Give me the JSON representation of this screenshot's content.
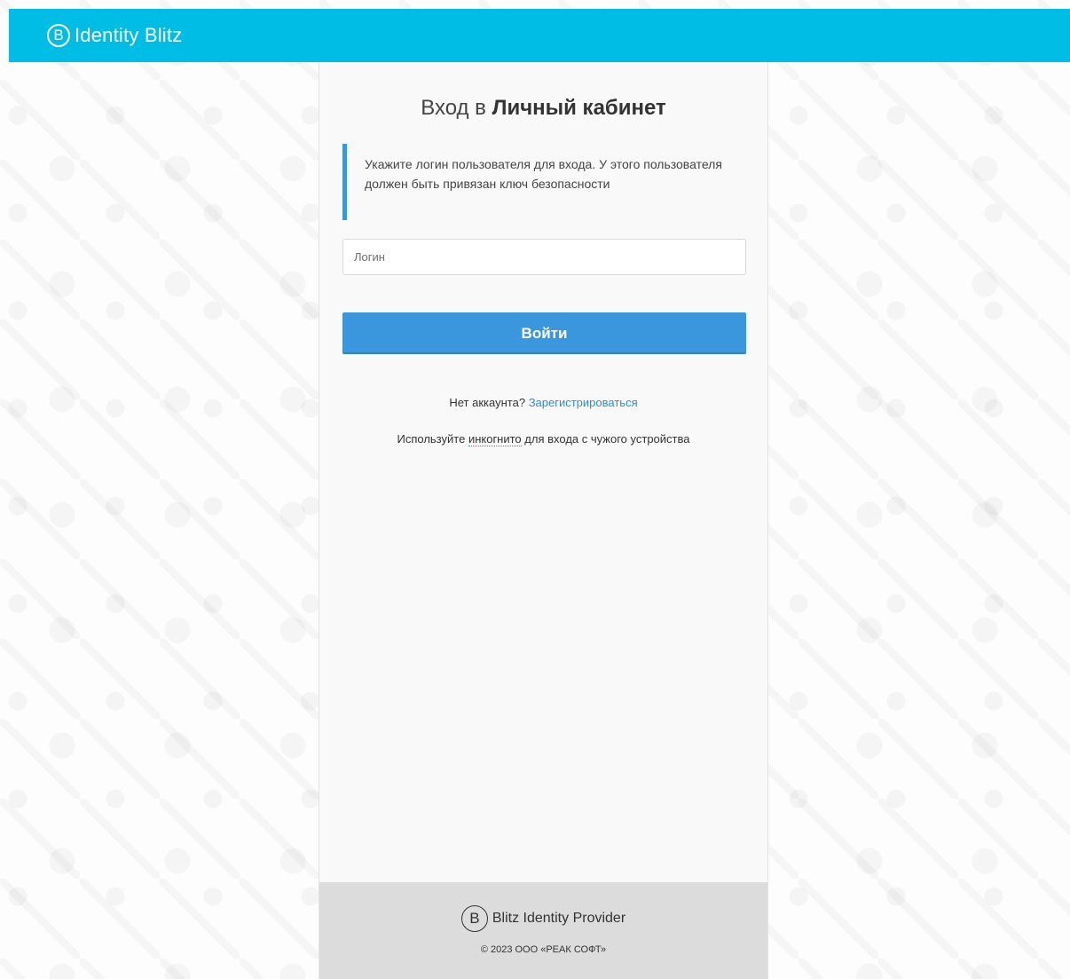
{
  "header": {
    "logo_letter": "B",
    "brand_name": "Identity Blitz"
  },
  "login": {
    "title_prefix": "Вход в",
    "title_bold": "Личный кабинет",
    "hint_text": "Укажите логин пользователя для входа. У этого пользователя должен быть привязан ключ безопасности",
    "login_placeholder": "Логин",
    "login_value": "",
    "submit_label": "Войти",
    "no_account_text": "Нет аккаунта?",
    "register_link": "Зарегистрироваться",
    "incognito_prefix": "Используйте",
    "incognito_word": "инкогнито",
    "incognito_suffix": "для входа с чужого устройства"
  },
  "footer": {
    "logo_letter": "B",
    "product_name": "Blitz Identity Provider",
    "copyright": "© 2023 ООО «РЕАК СОФТ»"
  },
  "colors": {
    "topbar": "#00bde6",
    "accent": "#3a96dd",
    "link": "#2d8ad6",
    "footer_bg": "#dcdcdc"
  },
  "icons": {
    "brand": "blitz-logo-icon",
    "footer": "blitz-logo-icon"
  }
}
